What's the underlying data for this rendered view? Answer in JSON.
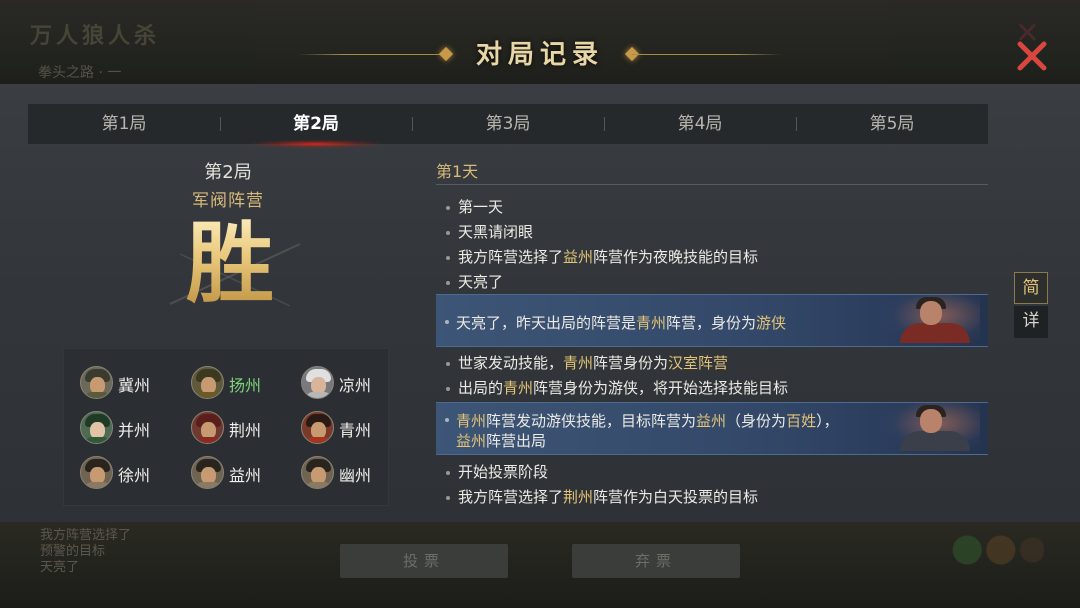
{
  "background": {
    "title": "万人狼人杀",
    "subtitle": "拳头之路 · 一",
    "log_lines": [
      "我方阵营选择了",
      "预警的目标",
      "天亮了"
    ],
    "buttons": [
      "投票",
      "弃票"
    ]
  },
  "dialog": {
    "title": "对局记录",
    "close_icon": "close-x-icon"
  },
  "tabs": [
    {
      "label": "第1局",
      "active": false
    },
    {
      "label": "第2局",
      "active": true
    },
    {
      "label": "第3局",
      "active": false
    },
    {
      "label": "第4局",
      "active": false
    },
    {
      "label": "第5局",
      "active": false
    }
  ],
  "result": {
    "round": "第2局",
    "camp": "军阀阵营",
    "outcome": "胜"
  },
  "players": [
    {
      "name": "冀州",
      "highlight": false,
      "hair": "#3a3a2e",
      "body": "#5a5a3c"
    },
    {
      "name": "扬州",
      "highlight": true,
      "hair": "#3b3a20",
      "body": "#6a5a2a"
    },
    {
      "name": "凉州",
      "highlight": false,
      "hair": "#e0e0e0",
      "body": "#b7b7b7"
    },
    {
      "name": "并州",
      "highlight": false,
      "hair": "#1f3a25",
      "body": "#2f5a3a"
    },
    {
      "name": "荆州",
      "highlight": false,
      "hair": "#5a1f1a",
      "body": "#8a2a22"
    },
    {
      "name": "青州",
      "highlight": false,
      "hair": "#2a1a16",
      "body": "#a6341f"
    },
    {
      "name": "徐州",
      "highlight": false,
      "hair": "#2a241f",
      "body": "#8a7a62"
    },
    {
      "name": "益州",
      "highlight": false,
      "hair": "#2a241f",
      "body": "#8a7a62"
    },
    {
      "name": "幽州",
      "highlight": false,
      "hair": "#2a241f",
      "body": "#8a7a62"
    }
  ],
  "log": {
    "day": "第1天",
    "lines": {
      "l1": "第一天",
      "l2": "天黑请闭眼",
      "l3_a": "我方阵营选择了",
      "l3_b": "益州",
      "l3_c": "阵营作为夜晚技能的目标",
      "l4": "天亮了",
      "b1_a": "天亮了，昨天出局的阵营是",
      "b1_b": "青州",
      "b1_c": "阵营，身份为",
      "b1_d": "游侠",
      "l5_a": "世家发动技能，",
      "l5_b": "青州",
      "l5_c": "阵营身份为",
      "l5_d": "汉室阵营",
      "l6_a": "出局的",
      "l6_b": "青州",
      "l6_c": "阵营身份为游侠，将开始选择技能目标",
      "b2_a": "青州",
      "b2_b": "阵营发动游侠技能，目标阵营为",
      "b2_c": "益州",
      "b2_d": "（身份为",
      "b2_e": "百姓",
      "b2_f": "），",
      "b2_g": "益州",
      "b2_h": "阵营出局",
      "l7": "开始投票阶段",
      "l8_a": "我方阵营选择了",
      "l8_b": "荆州",
      "l8_c": "阵营作为白天投票的目标"
    }
  },
  "view_toggle": {
    "simple": "简",
    "detail": "详"
  },
  "colors": {
    "accent_gold": "#e2c377",
    "highlight_green": "#7fd37a",
    "close_red": "#d8473d",
    "banner_blue": "#3d5576"
  }
}
